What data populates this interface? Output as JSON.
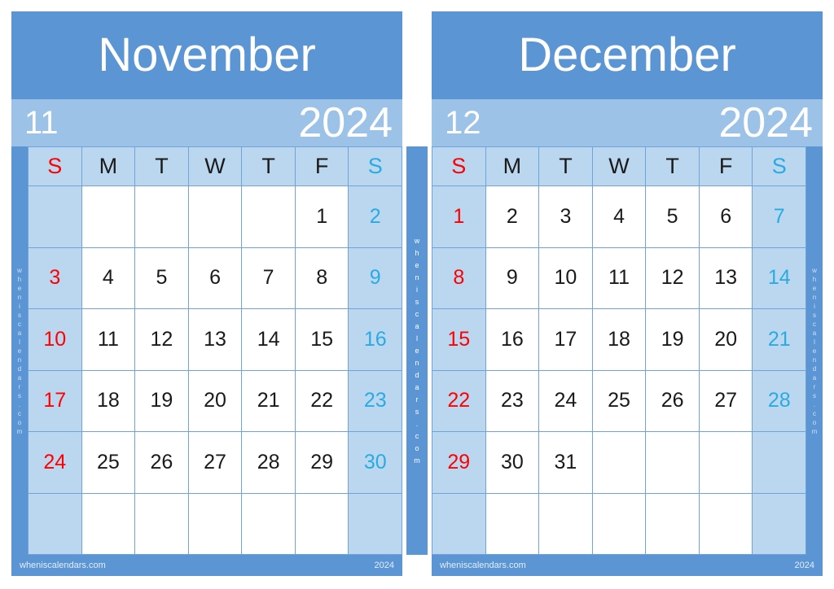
{
  "page": {
    "accent_blue": "#5b95d4",
    "year_band_blue": "#9cc2e8",
    "weekend_cell_blue": "#bad7ef",
    "sunday_color": "#ff0000",
    "saturday_color": "#29abe2",
    "grid_line_color": "#6fa3da",
    "watermark": "wheniscalendars.com"
  },
  "watermark_letters": [
    "w",
    "h",
    "e",
    "n",
    "i",
    "s",
    "c",
    "a",
    "l",
    "e",
    "n",
    "d",
    "a",
    "r",
    "s",
    ".",
    "c",
    "o",
    "m"
  ],
  "weekday_headers": [
    {
      "label": "S",
      "kind": "sun"
    },
    {
      "label": "M",
      "kind": "weekday"
    },
    {
      "label": "T",
      "kind": "weekday"
    },
    {
      "label": "W",
      "kind": "weekday"
    },
    {
      "label": "T",
      "kind": "weekday"
    },
    {
      "label": "F",
      "kind": "weekday"
    },
    {
      "label": "S",
      "kind": "sat"
    }
  ],
  "months": [
    {
      "name": "November",
      "number": "11",
      "year": "2024",
      "footer_site": "wheniscalendars.com",
      "footer_year": "2024",
      "weeks": [
        [
          "",
          "",
          "",
          "",
          "",
          "1",
          "2"
        ],
        [
          "3",
          "4",
          "5",
          "6",
          "7",
          "8",
          "9"
        ],
        [
          "10",
          "11",
          "12",
          "13",
          "14",
          "15",
          "16"
        ],
        [
          "17",
          "18",
          "19",
          "20",
          "21",
          "22",
          "23"
        ],
        [
          "24",
          "25",
          "26",
          "27",
          "28",
          "29",
          "30"
        ],
        [
          "",
          "",
          "",
          "",
          "",
          "",
          ""
        ]
      ]
    },
    {
      "name": "December",
      "number": "12",
      "year": "2024",
      "footer_site": "wheniscalendars.com",
      "footer_year": "2024",
      "weeks": [
        [
          "1",
          "2",
          "3",
          "4",
          "5",
          "6",
          "7"
        ],
        [
          "8",
          "9",
          "10",
          "11",
          "12",
          "13",
          "14"
        ],
        [
          "15",
          "16",
          "17",
          "18",
          "19",
          "20",
          "21"
        ],
        [
          "22",
          "23",
          "24",
          "25",
          "26",
          "27",
          "28"
        ],
        [
          "29",
          "30",
          "31",
          "",
          "",
          "",
          ""
        ],
        [
          "",
          "",
          "",
          "",
          "",
          "",
          ""
        ]
      ]
    }
  ]
}
